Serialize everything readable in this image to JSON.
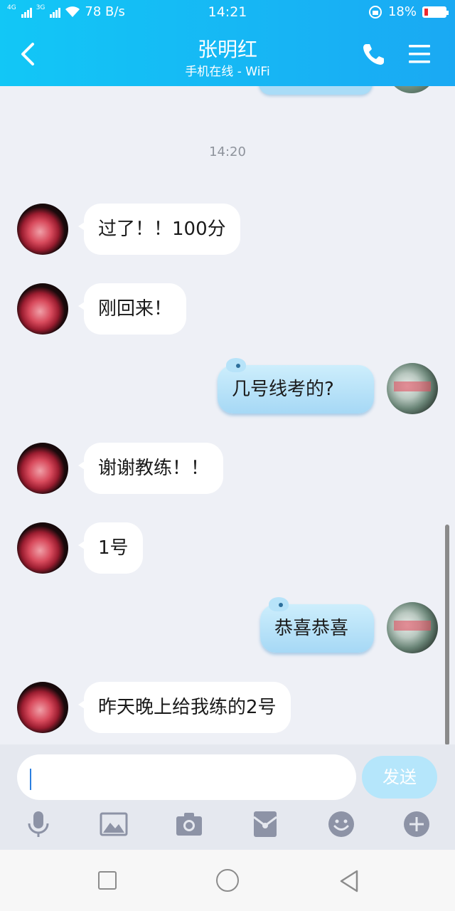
{
  "status_bar": {
    "network_label": "78 B/s",
    "time": "14:21",
    "battery_percent": "18%",
    "battery_level": 0.18,
    "signal_tags": [
      "4G",
      "3G"
    ]
  },
  "header": {
    "title": "张明红",
    "subtitle": "手机在线 - WiFi",
    "background_color": "#12c7f6"
  },
  "chat": {
    "timestamp": "14:20",
    "messages": [
      {
        "sender": "contact",
        "text": "过了！！100分"
      },
      {
        "sender": "contact",
        "text": "刚回来！"
      },
      {
        "sender": "me",
        "text": "几号线考的?"
      },
      {
        "sender": "contact",
        "text": "谢谢教练！！"
      },
      {
        "sender": "contact",
        "text": "1号"
      },
      {
        "sender": "me",
        "text": "恭喜恭喜"
      },
      {
        "sender": "contact",
        "text": "昨天晚上给我练的2号"
      }
    ]
  },
  "input_bar": {
    "input_value": "",
    "send_label": "发送",
    "tools": [
      "microphone-icon",
      "image-icon",
      "camera-icon",
      "red-packet-icon",
      "emoji-icon",
      "plus-icon"
    ]
  },
  "nav_bar": {
    "buttons": [
      "recent-apps-icon",
      "home-icon",
      "back-icon"
    ]
  },
  "colors": {
    "accent": "#1aa9f3",
    "outgoing_bubble": "#a6d8f5",
    "incoming_bubble": "#ffffff",
    "send_button": "#b5e6fb"
  }
}
